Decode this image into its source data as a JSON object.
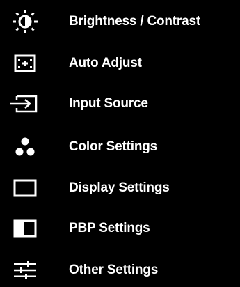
{
  "menu": {
    "items": [
      {
        "label": "Brightness / Contrast",
        "icon": "brightness-icon"
      },
      {
        "label": "Auto Adjust",
        "icon": "auto-adjust-icon"
      },
      {
        "label": "Input Source",
        "icon": "input-source-icon"
      },
      {
        "label": "Color Settings",
        "icon": "color-settings-icon"
      },
      {
        "label": "Display Settings",
        "icon": "display-settings-icon"
      },
      {
        "label": "PBP Settings",
        "icon": "pbp-settings-icon"
      },
      {
        "label": "Other Settings",
        "icon": "other-settings-icon"
      }
    ]
  },
  "colors": {
    "background": "#000000",
    "foreground": "#ffffff"
  }
}
